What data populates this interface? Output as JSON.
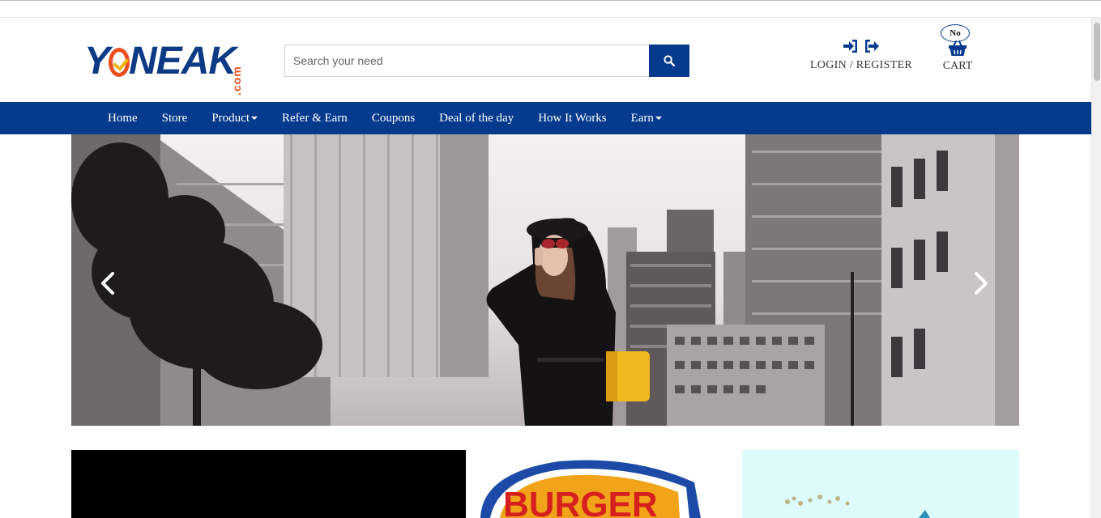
{
  "brand": {
    "logo_text": "YONEAK",
    "logo_suffix": ".com"
  },
  "search": {
    "placeholder": "Search your need",
    "icon": "search-icon"
  },
  "account": {
    "login_label": "LOGIN / REGISTER",
    "icons": [
      "sign-in-icon",
      "sign-out-icon"
    ]
  },
  "cart": {
    "badge": "No",
    "label": "CART",
    "icon": "shopping-basket-icon"
  },
  "nav": {
    "items": [
      {
        "label": "Home",
        "dropdown": false
      },
      {
        "label": "Store",
        "dropdown": false
      },
      {
        "label": "Product",
        "dropdown": true
      },
      {
        "label": "Refer & Earn",
        "dropdown": false
      },
      {
        "label": "Coupons",
        "dropdown": false
      },
      {
        "label": "Deal of the day",
        "dropdown": false
      },
      {
        "label": "How It Works",
        "dropdown": false
      },
      {
        "label": "Earn",
        "dropdown": true
      }
    ]
  },
  "carousel": {
    "prev_icon": "chevron-left-icon",
    "next_icon": "chevron-right-icon"
  },
  "promo_tiles": [
    {
      "name": "promo-tile-black"
    },
    {
      "name": "promo-tile-burger-king",
      "logo_text": "BURGER"
    },
    {
      "name": "promo-tile-cyan"
    }
  ],
  "colors": {
    "brand_blue": "#063a8c",
    "brand_orange": "#e84f21",
    "brand_yellow": "#f2b318",
    "nav_text": "#ffffff"
  }
}
